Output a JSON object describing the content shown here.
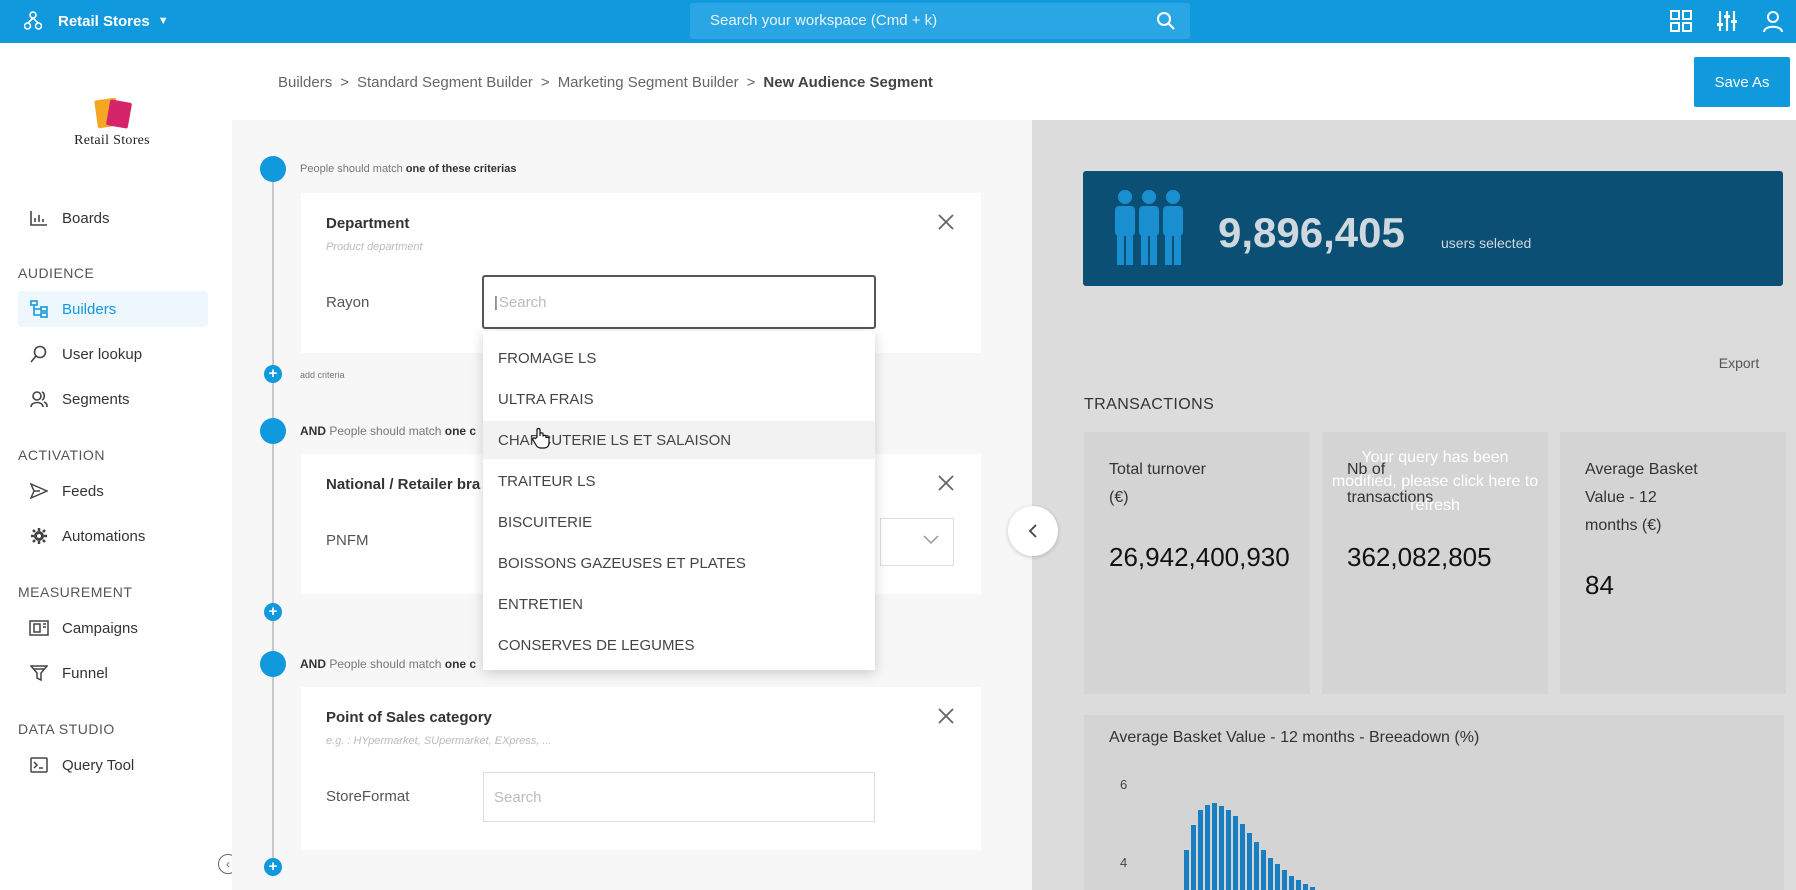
{
  "topbar": {
    "workspace": "Retail Stores",
    "search_placeholder": "Search your workspace (Cmd + k)"
  },
  "sidebar": {
    "logo_text": "Retail Stores",
    "items": [
      {
        "label": "Boards",
        "icon": "bar-chart-icon"
      },
      {
        "label": "Builders",
        "icon": "hierarchy-icon",
        "active": true
      },
      {
        "label": "User lookup",
        "icon": "user-search-icon"
      },
      {
        "label": "Segments",
        "icon": "users-icon"
      },
      {
        "label": "Feeds",
        "icon": "send-icon"
      },
      {
        "label": "Automations",
        "icon": "gear-icon"
      },
      {
        "label": "Campaigns",
        "icon": "campaign-icon"
      },
      {
        "label": "Funnel",
        "icon": "funnel-icon"
      },
      {
        "label": "Query Tool",
        "icon": "terminal-icon"
      }
    ],
    "sections": [
      "AUDIENCE",
      "ACTIVATION",
      "MEASUREMENT",
      "DATA STUDIO"
    ]
  },
  "breadcrumb": {
    "items": [
      "Builders",
      "Standard Segment Builder",
      "Marketing Segment Builder",
      "New Audience Segment"
    ],
    "separator": ">"
  },
  "actions": {
    "save_as": "Save As"
  },
  "builder": {
    "step1": {
      "prefix": "People should match",
      "bold": "one of these criterias"
    },
    "step2": {
      "and": "AND",
      "prefix": "People should match",
      "bold": "one c"
    },
    "step3": {
      "and": "AND",
      "prefix": "People should match",
      "bold": "one c"
    },
    "add_criteria": "add criteria",
    "cards": [
      {
        "title": "Department",
        "subtitle": "Product department",
        "field_label": "Rayon",
        "placeholder": "Search"
      },
      {
        "title": "National / Retailer bra",
        "field_label": "PNFM"
      },
      {
        "title": "Point of Sales category",
        "subtitle": "e.g. : HYpermarket, SUpermarket, EXpress, ...",
        "field_label": "StoreFormat",
        "placeholder": "Search"
      }
    ],
    "dropdown": [
      "FROMAGE LS",
      "ULTRA FRAIS",
      "CHARCUTERIE LS ET SALAISON",
      "TRAITEUR LS",
      "BISCUITERIE",
      "BOISSONS GAZEUSES ET PLATES",
      "ENTRETIEN",
      "CONSERVES DE LEGUMES"
    ],
    "dropdown_hover_index": 2
  },
  "stats": {
    "users_count": "9,896,405",
    "users_label": "users selected",
    "export": "Export",
    "transactions_title": "TRANSACTIONS",
    "refresh_message": "Your query has been modified, please click here to refresh",
    "kpis": [
      {
        "label_line1": "Total turnover",
        "label_line2": "(€)",
        "value": "26,942,400,930"
      },
      {
        "label_line1": "Nb of",
        "label_line2": "transactions",
        "value": "362,082,805"
      },
      {
        "label_line1": "Average Basket",
        "label_line2": "Value - 12",
        "label_line3": "months (€)",
        "value": "84"
      }
    ],
    "chart_title": "Average Basket Value - 12 months - Breeadown (%)",
    "chart_ticks": [
      "6",
      "4"
    ]
  },
  "colors": {
    "brand": "#1199dd",
    "banner": "#0c4f75",
    "dim_overlay": "#dcdcdc"
  }
}
